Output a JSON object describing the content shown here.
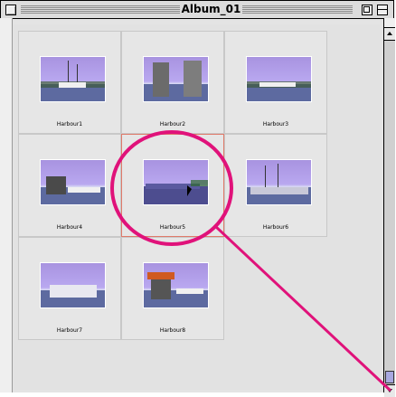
{
  "window": {
    "title": "Album_01"
  },
  "items": [
    {
      "label": "Harbour1"
    },
    {
      "label": "Harbour2"
    },
    {
      "label": "Harbour3"
    },
    {
      "label": "Harbour4"
    },
    {
      "label": "Harbour5"
    },
    {
      "label": "Harbour6"
    },
    {
      "label": "Harbour7"
    },
    {
      "label": "Harbour8"
    }
  ],
  "selection": {
    "selected_item": "Harbour5"
  },
  "annotation": {
    "color": "#e0127a"
  },
  "colors": {
    "selection_border": "#e07a6a",
    "sky": "#b9a8f0"
  }
}
